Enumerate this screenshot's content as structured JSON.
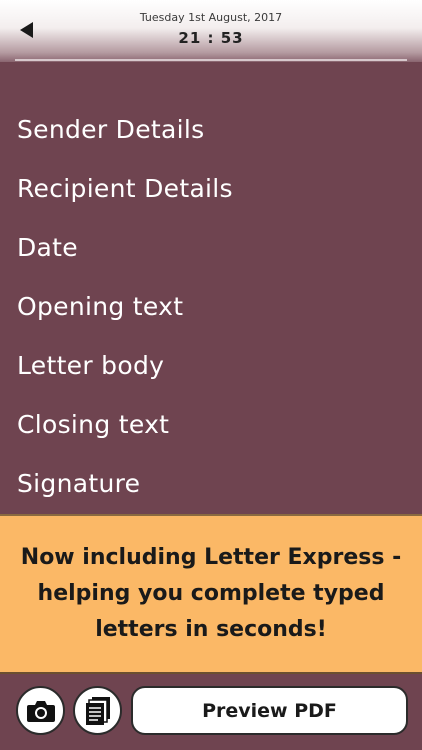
{
  "header": {
    "date": "Tuesday 1st August, 2017",
    "time": "21 : 53"
  },
  "menu": {
    "items": [
      {
        "label": "Sender Details"
      },
      {
        "label": "Recipient Details"
      },
      {
        "label": "Date"
      },
      {
        "label": "Opening text"
      },
      {
        "label": "Letter body"
      },
      {
        "label": "Closing text"
      },
      {
        "label": "Signature"
      }
    ]
  },
  "banner": {
    "text": "Now including Letter Express - helping you complete typed letters in seconds!"
  },
  "footer": {
    "camera_icon": "camera-icon",
    "documents_icon": "documents-icon",
    "preview_label": "Preview PDF"
  },
  "colors": {
    "background": "#6f4450",
    "banner": "#fbb866",
    "text_light": "#ffffff"
  }
}
